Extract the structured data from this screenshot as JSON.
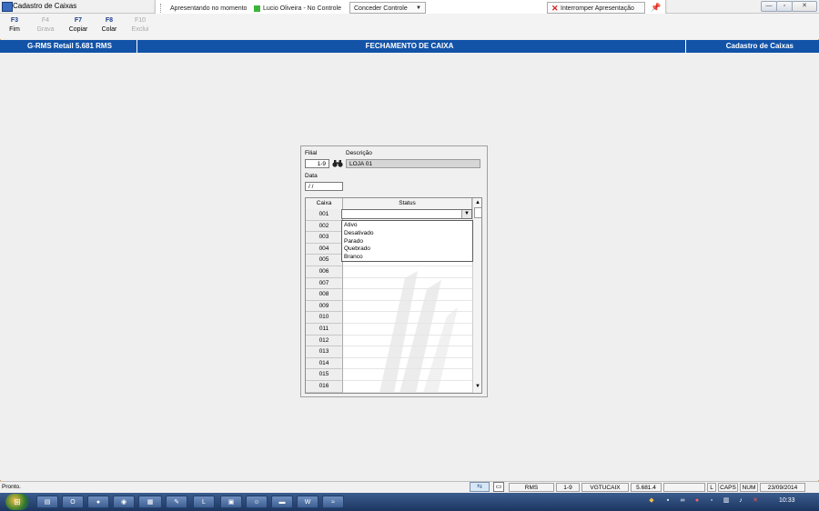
{
  "window": {
    "title": "Cadastro de Caixas"
  },
  "presentation": {
    "label": "Apresentando no momento",
    "user": "Lucio Oliveira - No Controle",
    "control_button": "Conceder Controle",
    "stop_button": "Interromper Apresentação"
  },
  "toolbar": {
    "keys": [
      {
        "key": "F3",
        "label": "Fim",
        "enabled": true
      },
      {
        "key": "F4",
        "label": "Grava",
        "enabled": false
      },
      {
        "key": "F7",
        "label": "Copiar",
        "enabled": true
      },
      {
        "key": "F8",
        "label": "Colar",
        "enabled": true
      },
      {
        "key": "F10",
        "label": "Exclui",
        "enabled": false
      }
    ]
  },
  "header": {
    "left": "G-RMS Retail 5.681 RMS",
    "center": "FECHAMENTO DE CAIXA",
    "right": "Cadastro de Caixas",
    "color": "#1253a8"
  },
  "form": {
    "filial_label": "Filial",
    "filial_value": "1-9",
    "descricao_label": "Descrição",
    "descricao_value": "LOJA 01",
    "data_label": "Data",
    "data_value": "/ /"
  },
  "grid": {
    "col_caixa": "Caixa",
    "col_status": "Status",
    "rows": [
      "001",
      "002",
      "003",
      "004",
      "005",
      "006",
      "007",
      "008",
      "009",
      "010",
      "011",
      "012",
      "013",
      "014",
      "015",
      "016"
    ]
  },
  "dropdown": {
    "selected": "",
    "options": [
      "Ativo",
      "Desativado",
      "Parado",
      "Quebrado",
      "Branco"
    ]
  },
  "statusbar": {
    "text": "Pronto.",
    "cells": [
      "RMS",
      "1-9",
      "VGTUCAIX",
      "5.681.4",
      "",
      "L",
      "CAPS",
      "NUM",
      "23/09/2014"
    ]
  },
  "taskbar": {
    "time": "10:33"
  }
}
